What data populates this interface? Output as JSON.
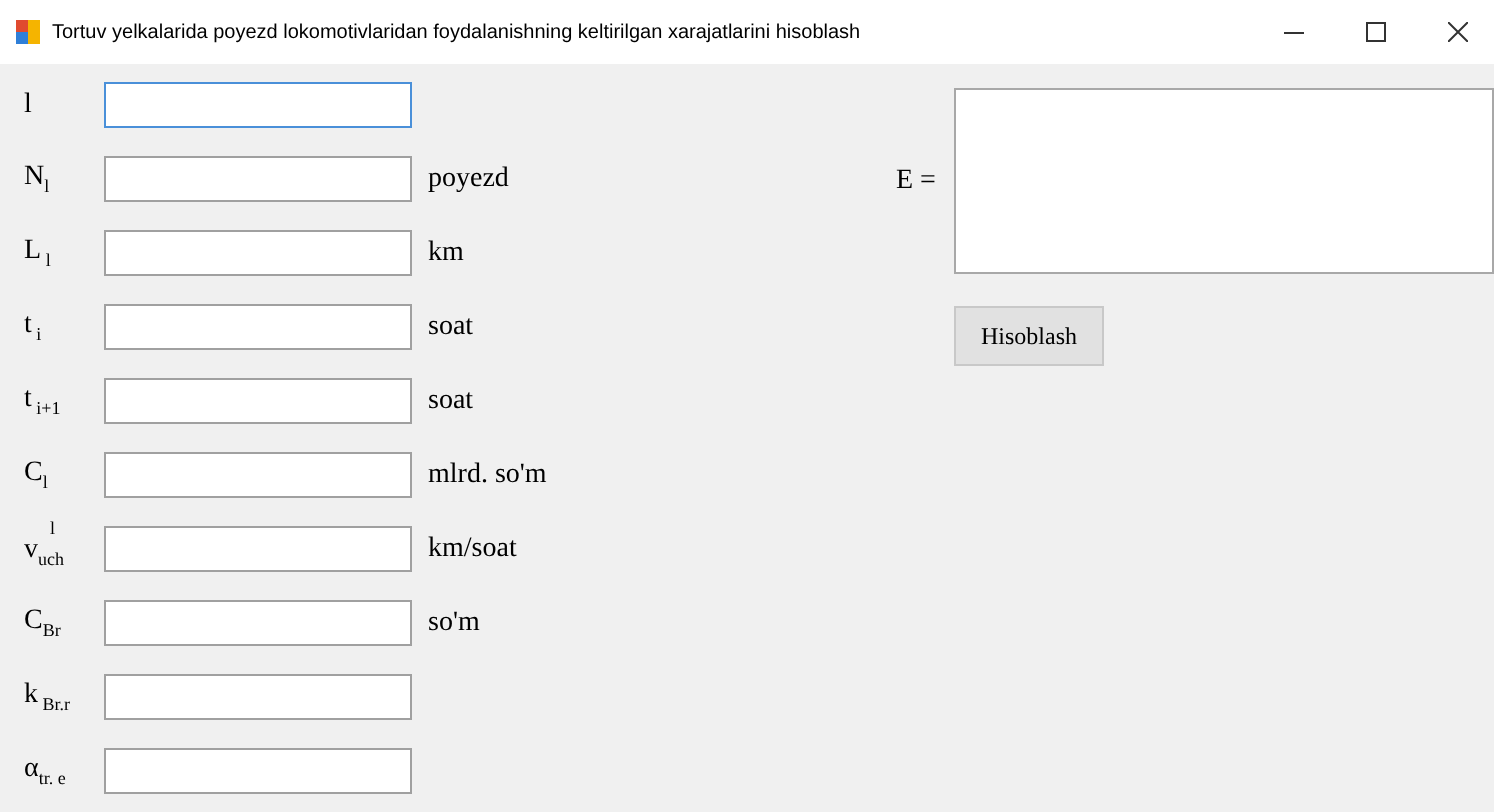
{
  "window": {
    "title": "Tortuv yelkalarida poyezd lokomotivlaridan foydalanishning keltirilgan xarajatlarini hisoblash"
  },
  "inputs": [
    {
      "label": "l",
      "focused": true
    },
    {
      "label": "N$_{l}$",
      "unit": "poyezd",
      "focused": false
    },
    {
      "label": "L$_{ l}$",
      "unit": "km",
      "focused": false
    },
    {
      "label": "t$_{ i}$",
      "unit": "soat",
      "focused": false
    },
    {
      "label": "t$_{ i+1}$",
      "unit": "soat",
      "focused": false
    },
    {
      "label": "C$_{l}$",
      "unit": "mlrd. so'm",
      "focused": false
    },
    {
      "label": "v$^{l}$$_{uch}$",
      "unit": "km/soat",
      "focused": false
    },
    {
      "label": "C$_{Br}$",
      "unit": "so'm",
      "focused": false
    },
    {
      "label": "k$_{ Br.r}$",
      "focused": false
    },
    {
      "label": "α$_{tr. e}$",
      "focused": false
    }
  ],
  "result": {
    "label": "E ="
  },
  "calculate_button": {
    "label": "Hisoblash"
  }
}
